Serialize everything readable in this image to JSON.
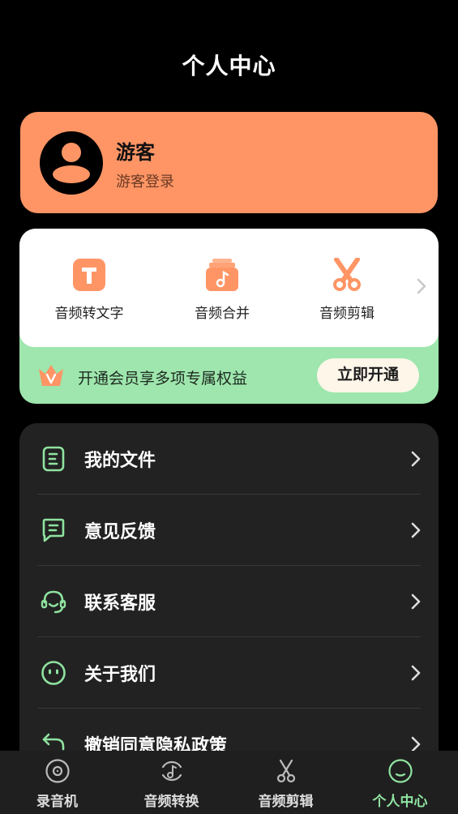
{
  "header": {
    "title": "个人中心"
  },
  "profile": {
    "name": "游客",
    "login_label": "游客登录"
  },
  "tools": {
    "items": [
      {
        "label": "音频转文字",
        "icon": "text-convert-icon"
      },
      {
        "label": "音频合并",
        "icon": "merge-icon"
      },
      {
        "label": "音频剪辑",
        "icon": "scissors-icon"
      }
    ]
  },
  "vip": {
    "text": "开通会员享多项专属权益",
    "button_label": "立即开通"
  },
  "menu": {
    "items": [
      {
        "label": "我的文件",
        "icon": "file-icon"
      },
      {
        "label": "意见反馈",
        "icon": "feedback-icon"
      },
      {
        "label": "联系客服",
        "icon": "headset-icon"
      },
      {
        "label": "关于我们",
        "icon": "face-icon"
      },
      {
        "label": "撤销同意隐私政策",
        "icon": "undo-icon"
      }
    ]
  },
  "tabbar": {
    "items": [
      {
        "label": "录音机",
        "icon": "record-icon"
      },
      {
        "label": "音频转换",
        "icon": "music-convert-icon"
      },
      {
        "label": "音频剪辑",
        "icon": "scissors-icon"
      },
      {
        "label": "个人中心",
        "icon": "smile-icon"
      }
    ],
    "active_index": 3
  },
  "colors": {
    "accent_orange": "#ff9565",
    "accent_green": "#8fe3a0",
    "vip_bg": "#9ee6ad",
    "background": "#000000",
    "card_dark": "#222222"
  }
}
